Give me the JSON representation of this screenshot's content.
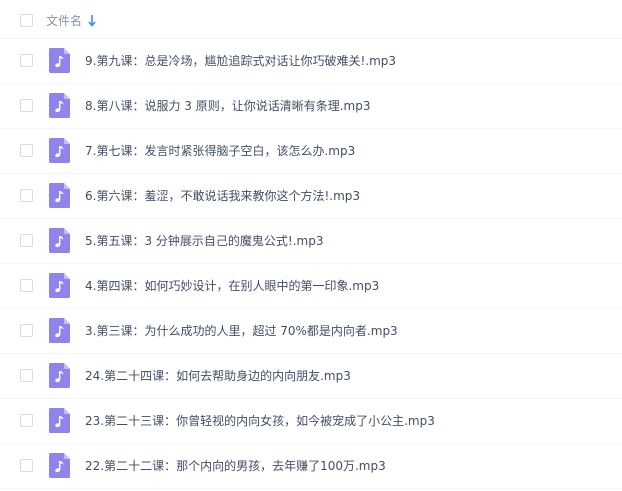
{
  "header": {
    "column_label": "文件名",
    "sort_icon": "arrow-down-icon",
    "sort_color": "#3b8cff"
  },
  "file_icon": {
    "name": "audio-file-icon",
    "color": "#8f83ec",
    "symbol": "♪"
  },
  "files": [
    {
      "name": "9.第九课：总是冷场，尴尬追踪式对话让你巧破难关!.mp3"
    },
    {
      "name": "8.第八课：说服力 3 原则，让你说话清晰有条理.mp3"
    },
    {
      "name": "7.第七课：发言时紧张得脑子空白，该怎么办.mp3"
    },
    {
      "name": "6.第六课：羞涩，不敢说话我来教你这个方法!.mp3"
    },
    {
      "name": "5.第五课：3 分钟展示自己的魔鬼公式!.mp3"
    },
    {
      "name": "4.第四课：如何巧妙设计，在别人眼中的第一印象.mp3"
    },
    {
      "name": "3.第三课：为什么成功的人里，超过 70%都是内向者.mp3"
    },
    {
      "name": "24.第二十四课：如何去帮助身边的内向朋友.mp3"
    },
    {
      "name": "23.第二十三课：你曾轻视的内向女孩，如今被宠成了小公主.mp3"
    },
    {
      "name": "22.第二十二课：那个内向的男孩，去年赚了100万.mp3"
    }
  ]
}
